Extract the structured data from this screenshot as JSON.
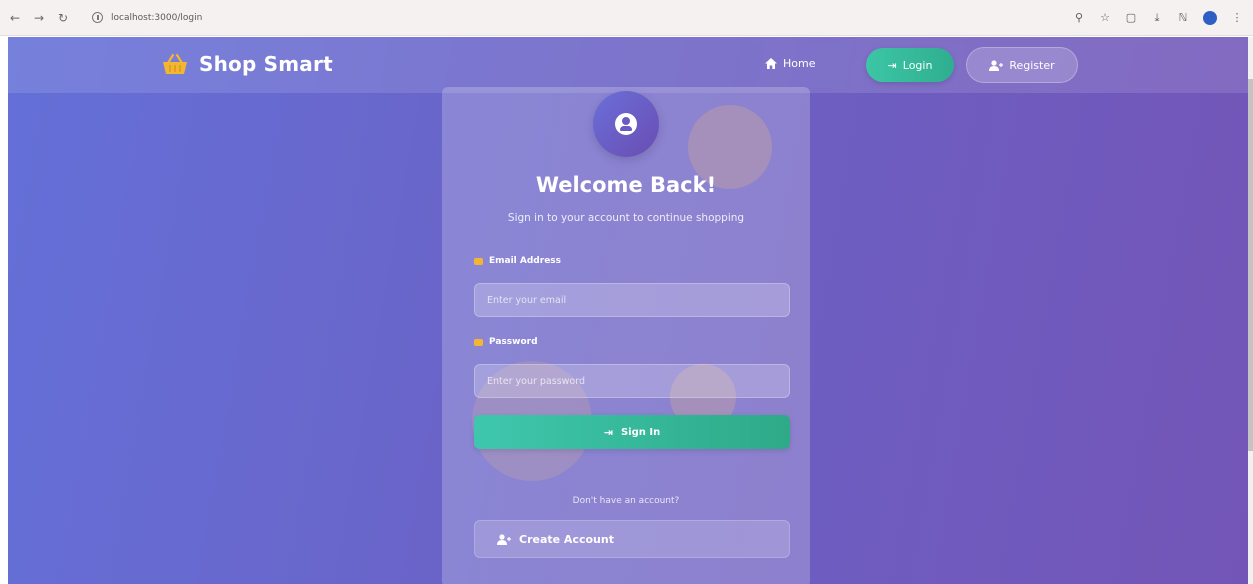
{
  "browser": {
    "url": "localhost:3000/login",
    "back_glyph": "←",
    "forward_glyph": "→",
    "reload_glyph": "↻",
    "right_icons": [
      "⚲",
      "☆",
      "▢",
      "⤓",
      "ℕ",
      "⋮"
    ]
  },
  "navbar": {
    "brand": "Shop Smart",
    "home": "Home",
    "login": "Login",
    "register": "Register"
  },
  "login_card": {
    "title": "Welcome Back!",
    "subtitle": "Sign in to your account to continue shopping",
    "email_label": "Email Address",
    "email_placeholder": "Enter your email",
    "password_label": "Password",
    "password_placeholder": "Enter your password",
    "signin_button": "Sign In",
    "no_account_text": "Don't have an account?",
    "create_account_button": "Create Account"
  },
  "colors": {
    "bg_start": "#6470d8",
    "bg_end": "#7355b7",
    "accent_green": "#3cc6a6",
    "basket_yellow": "#f2b632"
  }
}
